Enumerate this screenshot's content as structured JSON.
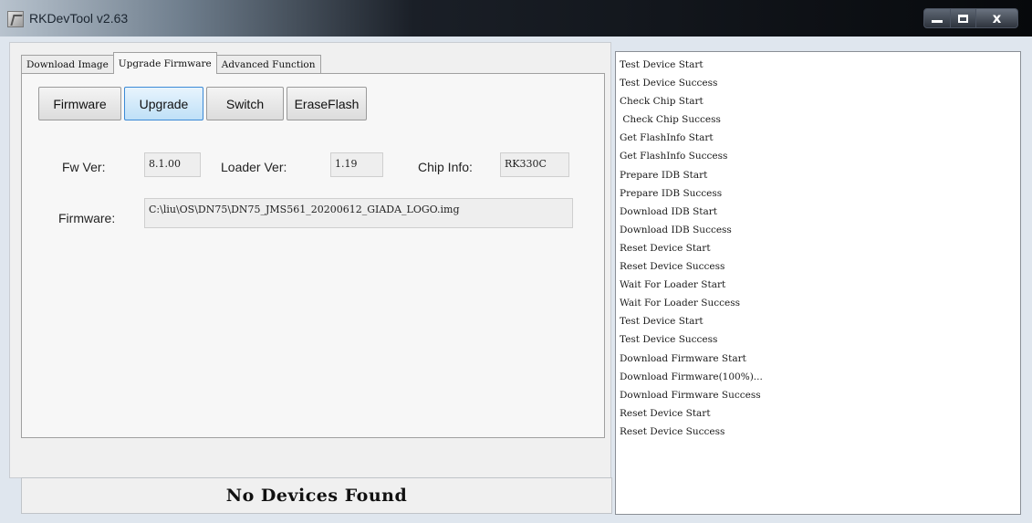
{
  "window": {
    "title": "RKDevTool v2.63",
    "controls": {
      "minimize": "minimize-icon",
      "maximize": "maximize-icon",
      "close": "x"
    }
  },
  "tabs": [
    {
      "label": "Download Image",
      "active": false
    },
    {
      "label": "Upgrade Firmware",
      "active": true
    },
    {
      "label": "Advanced Function",
      "active": false
    }
  ],
  "buttons": {
    "firmware": "Firmware",
    "upgrade": "Upgrade",
    "switch": "Switch",
    "erase_flash": "EraseFlash"
  },
  "info": {
    "fw_ver_label": "Fw Ver:",
    "fw_ver_value": "8.1.00",
    "loader_ver_label": "Loader Ver:",
    "loader_ver_value": "1.19",
    "chip_info_label": "Chip Info:",
    "chip_info_value": "RK330C",
    "firmware_label": "Firmware:",
    "firmware_path": "C:\\liu\\OS\\DN75\\DN75_JMS561_20200612_GIADA_LOGO.img"
  },
  "status": "No Devices Found",
  "log": [
    "Test Device Start",
    "Test Device Success",
    "Check Chip Start",
    " Check Chip Success",
    "Get FlashInfo Start",
    "Get FlashInfo Success",
    "Prepare IDB Start",
    "Prepare IDB Success",
    "Download IDB Start",
    "Download IDB Success",
    "Reset Device Start",
    "Reset Device Success",
    "Wait For Loader Start",
    "Wait For Loader Success",
    "Test Device Start",
    "Test Device Success",
    "Download Firmware Start",
    "Download Firmware(100%)...",
    "Download Firmware Success",
    "Reset Device Start",
    "Reset Device Success"
  ]
}
